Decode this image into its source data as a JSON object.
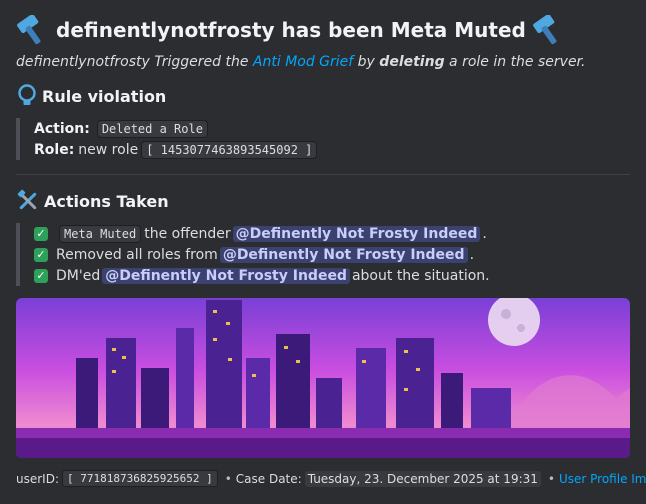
{
  "embed": {
    "title": "definentlynotfrosty has been Meta Muted",
    "title_icon": "hammer-icon",
    "description": {
      "user": "definentlynotfrosty",
      "triggered_text": "Triggered the",
      "rule_link": "Anti Mod Grief",
      "by_text": "by",
      "action_bold": "deleting",
      "tail": "a role in the server."
    },
    "rule_violation": {
      "heading": "Rule violation",
      "icon": "lightbulb-icon",
      "action_label": "Action:",
      "action_value": "Deleted a Role",
      "role_label": "Role:",
      "role_prefix": "new role",
      "role_id": "[ 1453077463893545092 ]"
    },
    "actions_taken": {
      "heading": "Actions Taken",
      "icon": "tools-icon",
      "items": [
        {
          "code": "Meta Muted",
          "text": "the offender",
          "mention": "@Definently Not Frosty Indeed",
          "tail": "."
        },
        {
          "text": "Removed all roles from",
          "mention": "@Definently Not Frosty Indeed",
          "tail": "."
        },
        {
          "text": "DM'ed",
          "mention": "@Definently Not Frosty Indeed",
          "tail": "about the situation."
        }
      ],
      "check_icon": "check-icon"
    },
    "footer": {
      "user_label": "userID:",
      "user_id": "[ 771818736825925652 ]",
      "sep": "•",
      "case_label": "Case Date:",
      "case_date": "Tuesday, 23. December 2025 at 19:31",
      "profile_link": "User Profile Image"
    },
    "colors": {
      "background": "#2b2d31",
      "link": "#00a8fc",
      "mention_bg": "#3c4270",
      "check": "#2fa05a"
    }
  }
}
